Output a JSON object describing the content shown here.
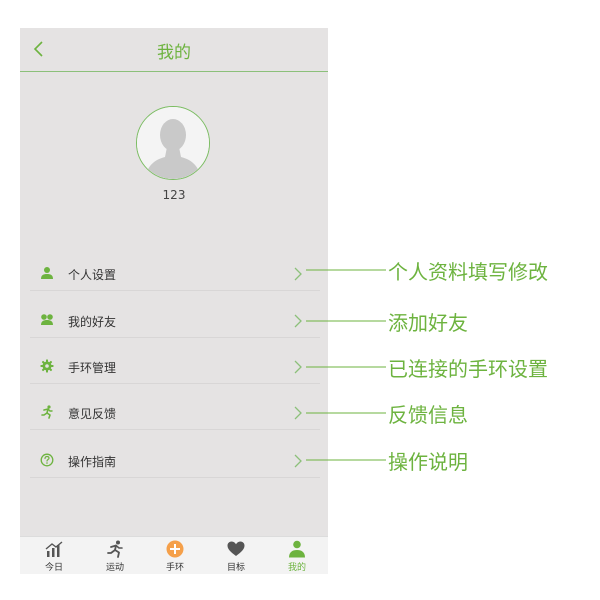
{
  "header": {
    "title": "我的"
  },
  "profile": {
    "username": "123"
  },
  "menu": {
    "items": [
      {
        "label": "个人设置",
        "icon": "user-icon"
      },
      {
        "label": "我的好友",
        "icon": "friends-icon"
      },
      {
        "label": "手环管理",
        "icon": "gear-icon"
      },
      {
        "label": "意见反馈",
        "icon": "runner-icon"
      },
      {
        "label": "操作指南",
        "icon": "help-icon"
      }
    ]
  },
  "tabbar": {
    "tabs": [
      {
        "label": "今日",
        "icon": "chart-icon",
        "active": false
      },
      {
        "label": "运动",
        "icon": "runner-icon",
        "active": false
      },
      {
        "label": "手环",
        "icon": "plus-circle-icon",
        "active": false
      },
      {
        "label": "目标",
        "icon": "heart-icon",
        "active": false
      },
      {
        "label": "我的",
        "icon": "user-icon",
        "active": true
      }
    ]
  },
  "annotations": {
    "items": [
      {
        "text": "个人资料填写修改"
      },
      {
        "text": "添加好友"
      },
      {
        "text": "已连接的手环设置"
      },
      {
        "text": "反馈信息"
      },
      {
        "text": "操作说明"
      }
    ]
  },
  "colors": {
    "accent": "#6db33f",
    "tab_orange": "#f5a04a",
    "background": "#e5e3e3"
  }
}
